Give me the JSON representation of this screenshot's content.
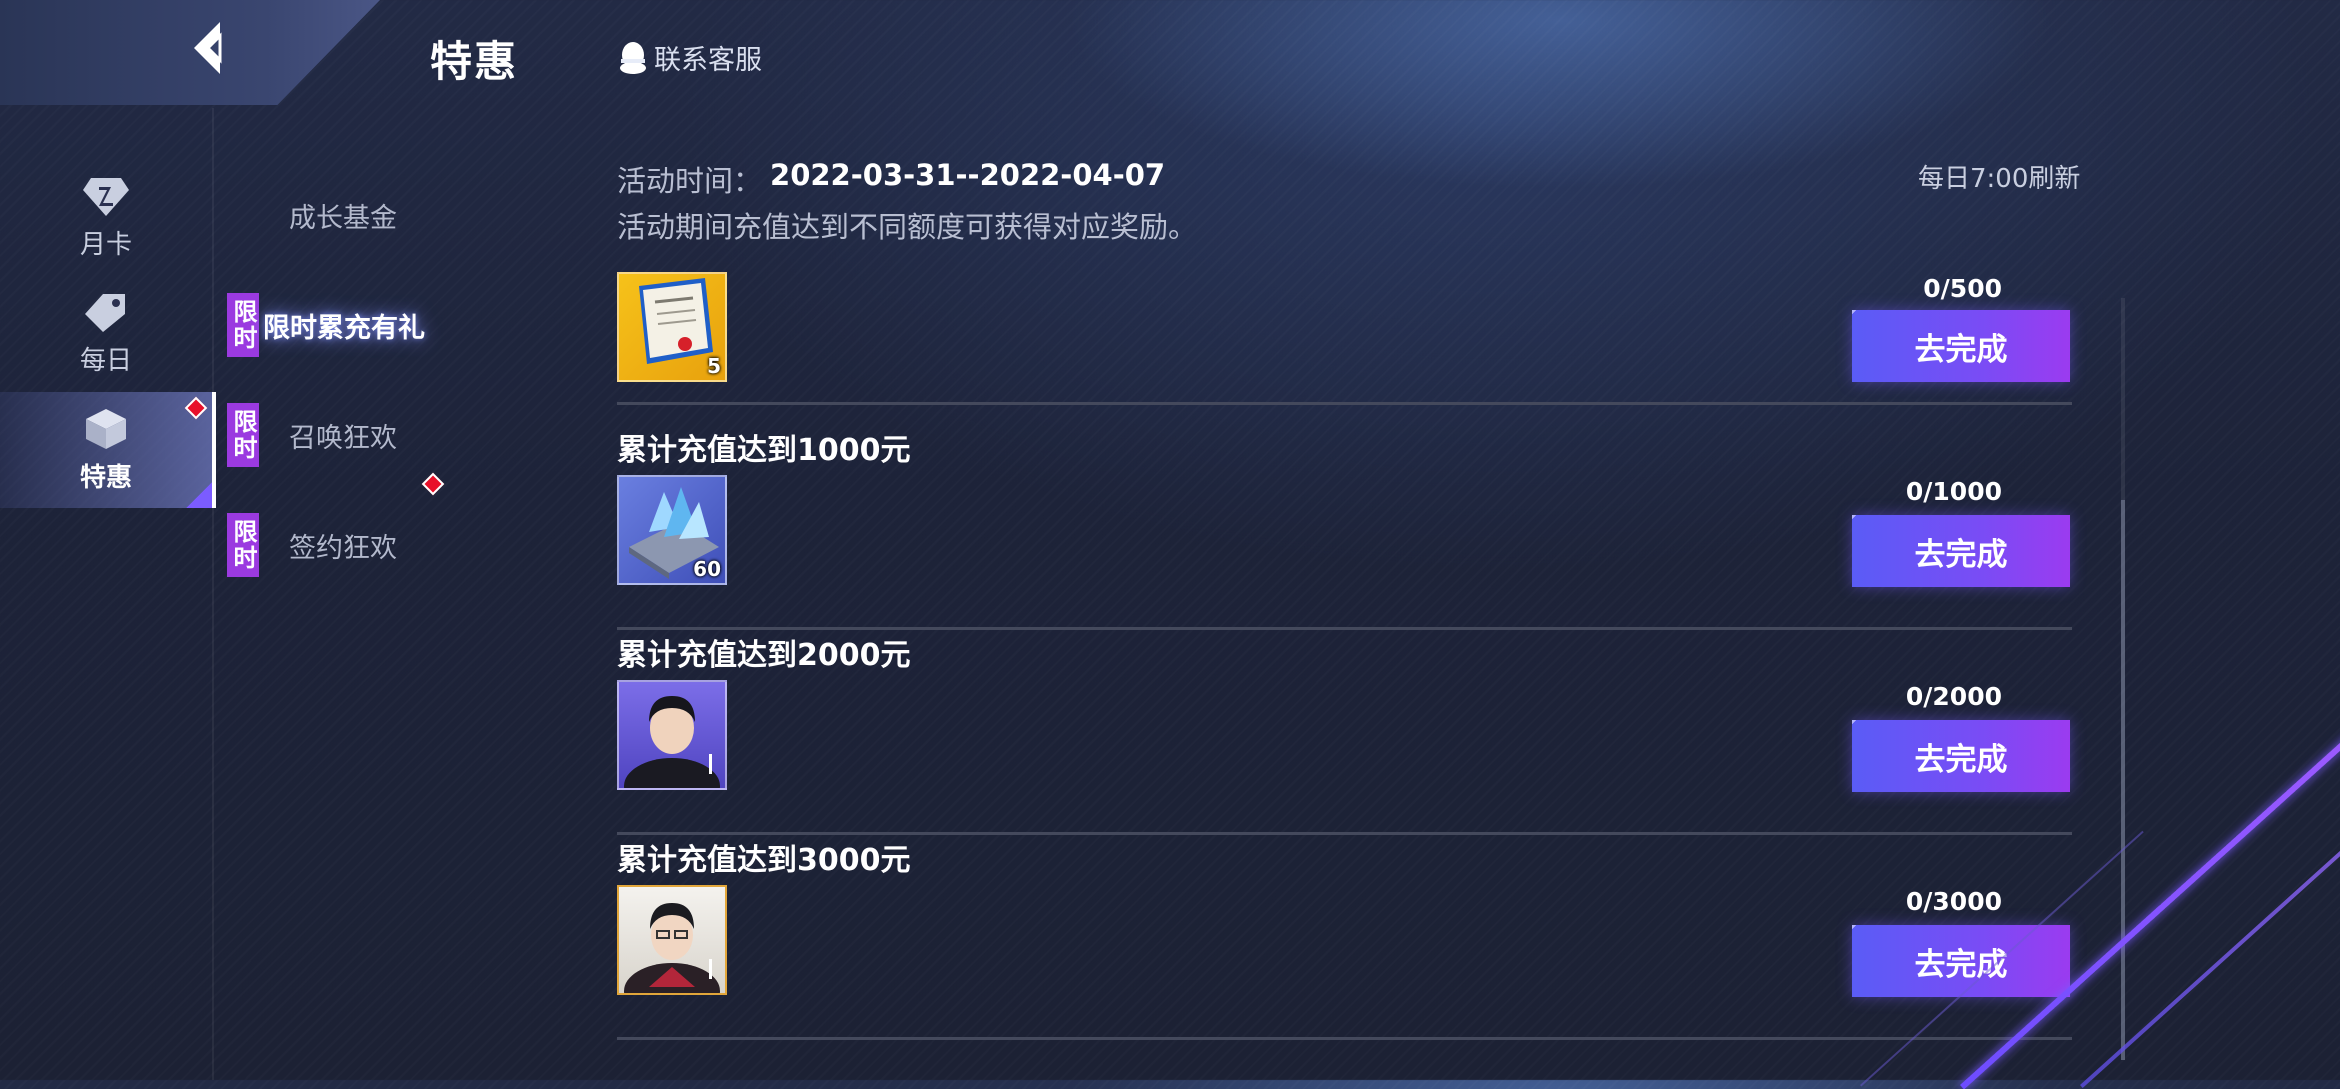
{
  "header": {
    "title": "特惠",
    "contact_label": "联系客服",
    "back_icon": "chevron-left-icon"
  },
  "main_nav": [
    {
      "label": "月卡",
      "icon": "diamond-card-icon",
      "active": false
    },
    {
      "label": "每日",
      "icon": "tag-icon",
      "active": false
    },
    {
      "label": "特惠",
      "icon": "cube-icon",
      "active": true,
      "badge": true
    }
  ],
  "sub_nav": [
    {
      "label": "成长基金",
      "tag": "",
      "active": false
    },
    {
      "label": "限时累充有礼",
      "tag": "限时",
      "active": true
    },
    {
      "label": "召唤狂欢",
      "tag": "限时",
      "active": false
    },
    {
      "label": "签约狂欢",
      "tag": "限时",
      "active": false
    }
  ],
  "activity": {
    "time_label": "活动时间：",
    "time_value": "2022-03-31--2022-04-07",
    "refresh_note": "每日7:00刷新",
    "description": "活动期间充值达到不同额度可获得对应奖励。"
  },
  "rewards": [
    {
      "title": "",
      "item": "certificate-icon",
      "count": "5",
      "progress": "0/500",
      "button": "去完成"
    },
    {
      "title": "累计充值达到1000元",
      "item": "crystal-icon",
      "count": "60",
      "progress": "0/1000",
      "button": "去完成"
    },
    {
      "title": "累计充值达到2000元",
      "item": "player-portrait-icon",
      "count": "1",
      "progress": "0/2000",
      "button": "去完成"
    },
    {
      "title": "累计充值达到3000元",
      "item": "player-portrait-icon",
      "count": "1",
      "progress": "0/3000",
      "button": "去完成"
    }
  ],
  "colors": {
    "accent_purple": "#9b3ae0",
    "button_start": "#5a5cf6",
    "button_end": "#9b3bf0",
    "badge_red": "#e8102a"
  }
}
